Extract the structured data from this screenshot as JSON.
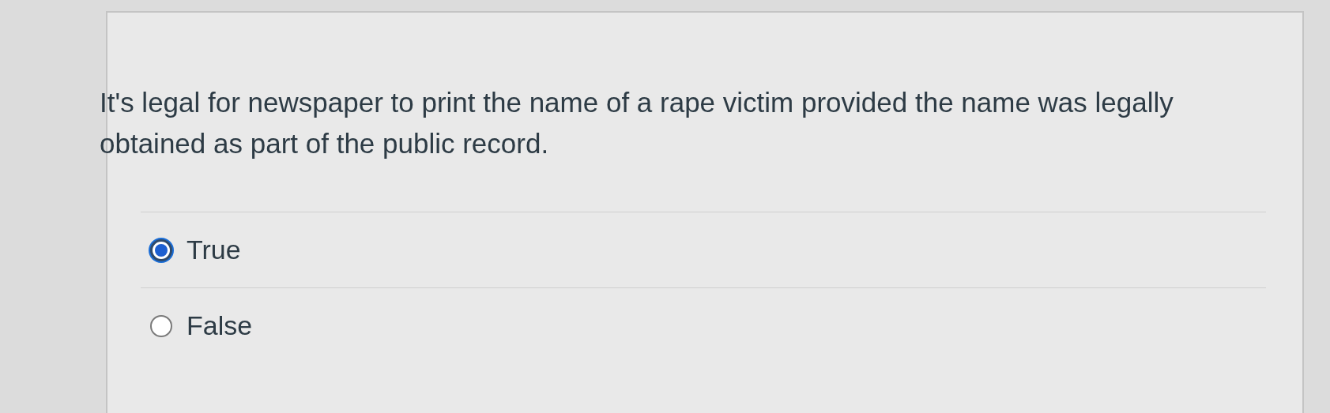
{
  "question": {
    "text": "It's legal for newspaper to print the name of a rape victim provided the name was legally obtained as part of the public record."
  },
  "options": [
    {
      "label": "True",
      "selected": true
    },
    {
      "label": "False",
      "selected": false
    }
  ]
}
